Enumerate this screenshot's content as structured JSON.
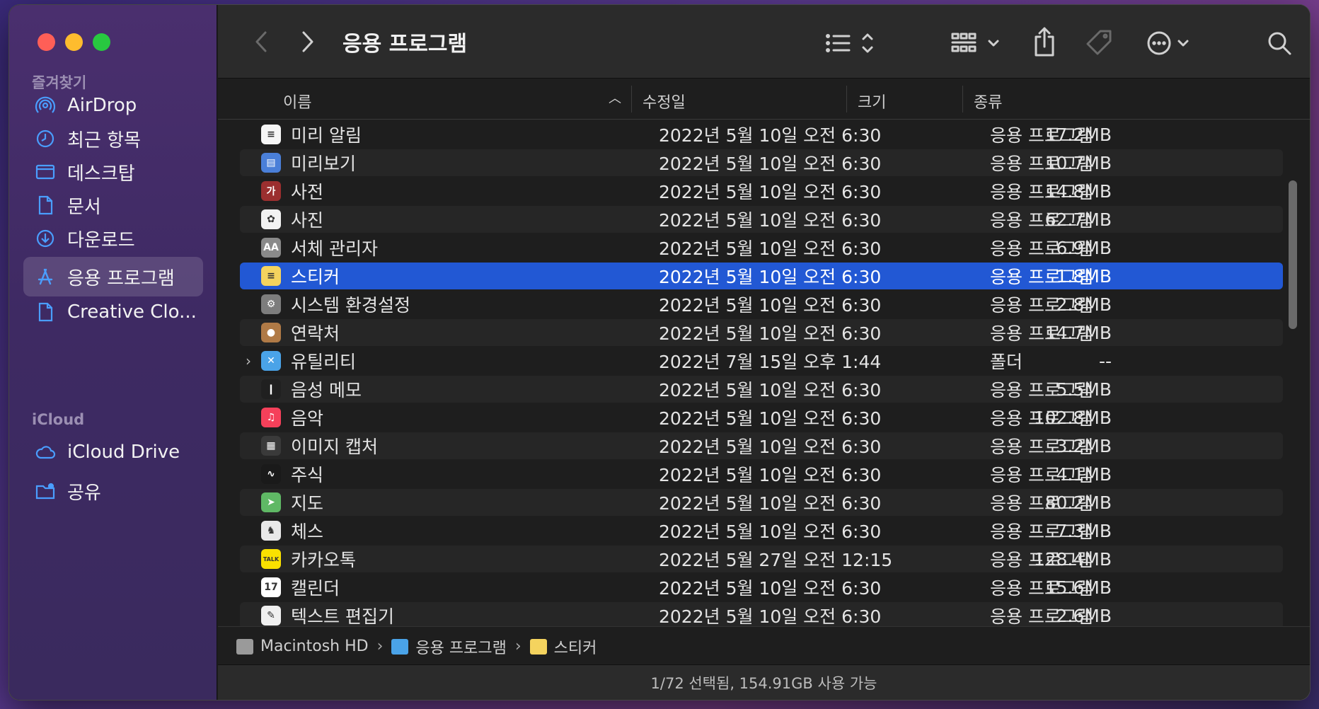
{
  "sidebar": {
    "favorites_title": "즐겨찾기",
    "favorites": [
      {
        "label": "AirDrop",
        "icon": "airdrop-icon"
      },
      {
        "label": "최근 항목",
        "icon": "clock-icon"
      },
      {
        "label": "데스크탑",
        "icon": "desktop-icon"
      },
      {
        "label": "문서",
        "icon": "document-icon"
      },
      {
        "label": "다운로드",
        "icon": "download-icon"
      },
      {
        "label": "응용 프로그램",
        "icon": "applications-icon",
        "active": true
      },
      {
        "label": "Creative Clo...",
        "icon": "document-icon"
      }
    ],
    "icloud_title": "iCloud",
    "icloud": [
      {
        "label": "iCloud Drive",
        "icon": "cloud-icon"
      },
      {
        "label": "공유",
        "icon": "shared-folder-icon"
      }
    ]
  },
  "toolbar": {
    "title": "응용 프로그램"
  },
  "columns": {
    "name": "이름",
    "date": "수정일",
    "size": "크기",
    "kind": "종류"
  },
  "files": [
    {
      "name": "미리 알림",
      "date": "2022년 5월 10일 오전 6:30",
      "size": "17.2MB",
      "kind": "응용 프로그램",
      "icon_color": "#f5f5f5",
      "icon_glyph": "≡"
    },
    {
      "name": "미리보기",
      "date": "2022년 5월 10일 오전 6:30",
      "size": "10.7MB",
      "kind": "응용 프로그램",
      "icon_color": "#4a7fd8",
      "icon_glyph": "▤"
    },
    {
      "name": "사전",
      "date": "2022년 5월 10일 오전 6:30",
      "size": "14.8MB",
      "kind": "응용 프로그램",
      "icon_color": "#9b2f2f",
      "icon_glyph": "가"
    },
    {
      "name": "사진",
      "date": "2022년 5월 10일 오전 6:30",
      "size": "62.7MB",
      "kind": "응용 프로그램",
      "icon_color": "#f2f2f2",
      "icon_glyph": "✿"
    },
    {
      "name": "서체 관리자",
      "date": "2022년 5월 10일 오전 6:30",
      "size": "6.9MB",
      "kind": "응용 프로그램",
      "icon_color": "#8a8a8a",
      "icon_glyph": "AA"
    },
    {
      "name": "스티커",
      "date": "2022년 5월 10일 오전 6:30",
      "size": "1.8MB",
      "kind": "응용 프로그램",
      "icon_color": "#f4d35e",
      "icon_glyph": "≡",
      "selected": true
    },
    {
      "name": "시스템 환경설정",
      "date": "2022년 5월 10일 오전 6:30",
      "size": "2.8MB",
      "kind": "응용 프로그램",
      "icon_color": "#7d7d7d",
      "icon_glyph": "⚙"
    },
    {
      "name": "연락처",
      "date": "2022년 5월 10일 오전 6:30",
      "size": "14.7MB",
      "kind": "응용 프로그램",
      "icon_color": "#b07a46",
      "icon_glyph": "●"
    },
    {
      "name": "유틸리티",
      "date": "2022년 7월 15일 오후 1:44",
      "size": "--",
      "kind": "폴더",
      "icon_color": "#4aa3e8",
      "icon_glyph": "✕",
      "folder": true
    },
    {
      "name": "음성 메모",
      "date": "2022년 5월 10일 오전 6:30",
      "size": "5.5MB",
      "kind": "응용 프로그램",
      "icon_color": "#202020",
      "icon_glyph": "❙"
    },
    {
      "name": "음악",
      "date": "2022년 5월 10일 오전 6:30",
      "size": "102.8MB",
      "kind": "응용 프로그램",
      "icon_color": "#f5405a",
      "icon_glyph": "♫"
    },
    {
      "name": "이미지 캡처",
      "date": "2022년 5월 10일 오전 6:30",
      "size": "3.2MB",
      "kind": "응용 프로그램",
      "icon_color": "#3a3a3a",
      "icon_glyph": "▦"
    },
    {
      "name": "주식",
      "date": "2022년 5월 10일 오전 6:30",
      "size": "4.1MB",
      "kind": "응용 프로그램",
      "icon_color": "#1a1a1a",
      "icon_glyph": "∿"
    },
    {
      "name": "지도",
      "date": "2022년 5월 10일 오전 6:30",
      "size": "80.2MB",
      "kind": "응용 프로그램",
      "icon_color": "#5fb865",
      "icon_glyph": "➤"
    },
    {
      "name": "체스",
      "date": "2022년 5월 10일 오전 6:30",
      "size": "7.3MB",
      "kind": "응용 프로그램",
      "icon_color": "#e8e8e8",
      "icon_glyph": "♞"
    },
    {
      "name": "카카오톡",
      "date": "2022년 5월 27일 오전 12:15",
      "size": "128.4MB",
      "kind": "응용 프로그램",
      "icon_color": "#fae100",
      "icon_glyph": "TALK"
    },
    {
      "name": "캘린더",
      "date": "2022년 5월 10일 오전 6:30",
      "size": "15.6MB",
      "kind": "응용 프로그램",
      "icon_color": "#ffffff",
      "icon_glyph": "17"
    },
    {
      "name": "텍스트 편집기",
      "date": "2022년 5월 10일 오전 6:30",
      "size": "2.6MB",
      "kind": "응용 프로그램",
      "icon_color": "#f0f0f0",
      "icon_glyph": "✎"
    }
  ],
  "pathbar": [
    {
      "label": "Macintosh HD",
      "icon": "disk-icon",
      "color": "#9a9a9a"
    },
    {
      "label": "응용 프로그램",
      "icon": "folder-icon",
      "color": "#4aa3e8"
    },
    {
      "label": "스티커",
      "icon": "stickies-icon",
      "color": "#f4d35e"
    }
  ],
  "status": "1/72 선택됨, 154.91GB 사용 가능"
}
